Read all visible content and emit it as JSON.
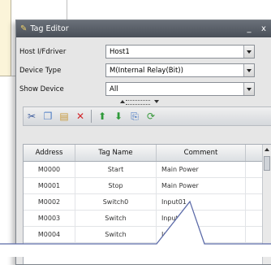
{
  "window": {
    "title": "Tag Editor",
    "minimize": "_",
    "close": "x"
  },
  "form": {
    "host": {
      "label": "Host I/Fdriver",
      "value": "Host1"
    },
    "device_type": {
      "label": "Device Type",
      "value": "M(Internal Relay(Bit))"
    },
    "show_device": {
      "label": "Show Device",
      "value": "All"
    }
  },
  "grid": {
    "headers": [
      "Address",
      "Tag Name",
      "Comment"
    ],
    "rows": [
      {
        "address": "M0000",
        "tag": "Start",
        "comment": "Main Power"
      },
      {
        "address": "M0001",
        "tag": "Stop",
        "comment": "Main Power"
      },
      {
        "address": "M0002",
        "tag": "Switch0",
        "comment": "Input01"
      },
      {
        "address": "M0003",
        "tag": "Switch",
        "comment": "Input02"
      },
      {
        "address": "M0004",
        "tag": "Switch",
        "comment": "Input03"
      }
    ]
  },
  "colors": {
    "titlebar": "#5a6069",
    "callout_stroke": "#5b6aa8",
    "background_fragment": "#fbf4d9"
  },
  "icons": [
    "cut-icon",
    "copy-icon",
    "paste-icon",
    "delete-icon",
    "move-up-icon",
    "move-down-icon",
    "export-icon",
    "refresh-icon"
  ]
}
